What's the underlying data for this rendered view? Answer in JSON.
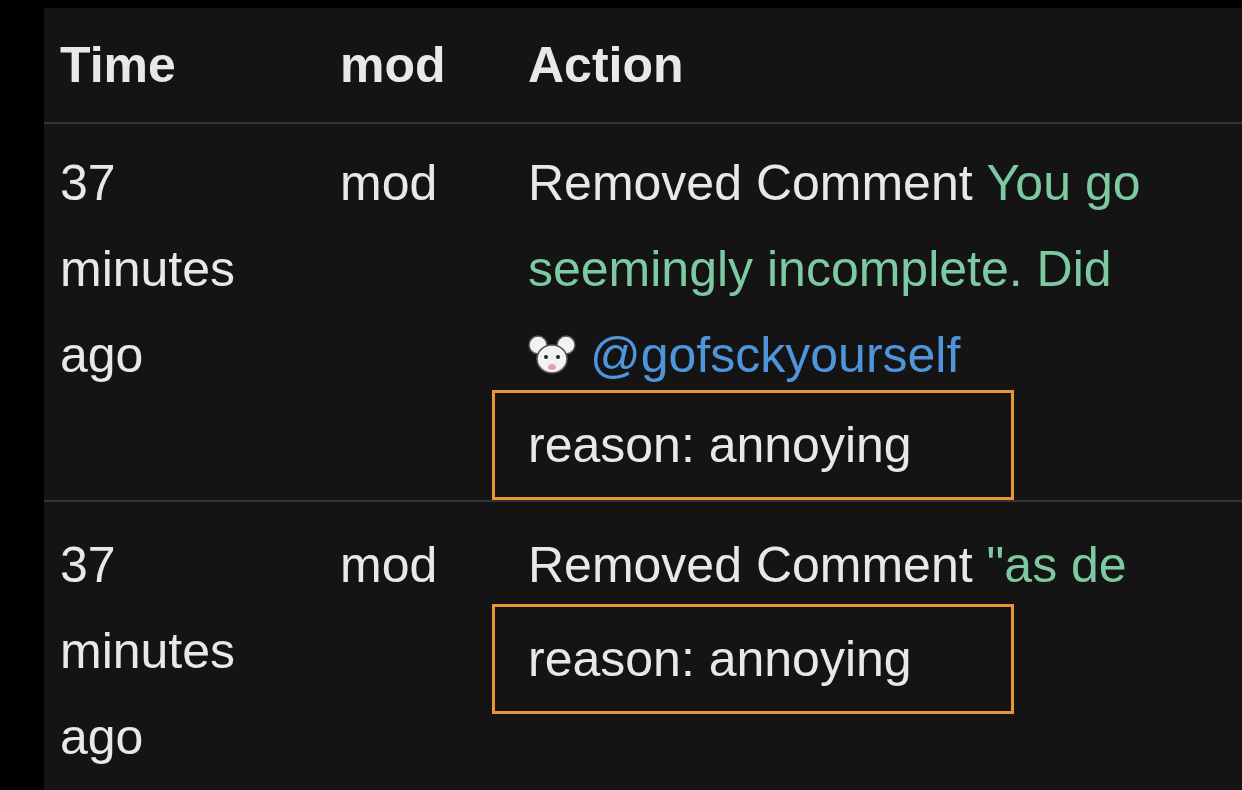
{
  "table": {
    "columns": [
      "Time",
      "mod",
      "Action"
    ],
    "rows": [
      {
        "time": "37 minutes ago",
        "mod": "mod",
        "action": {
          "label": "Removed Comment",
          "comment_lines": [
            "You go",
            "seemingly incomplete. Did"
          ],
          "author": "@gofsckyourself",
          "reason": "reason: annoying",
          "highlighted": true
        }
      },
      {
        "time": "37 minutes ago",
        "mod": "mod",
        "action": {
          "label": "Removed Comment",
          "comment_lines": [
            "\"as de"
          ],
          "reason": "reason: annoying",
          "highlighted": true
        }
      }
    ]
  }
}
